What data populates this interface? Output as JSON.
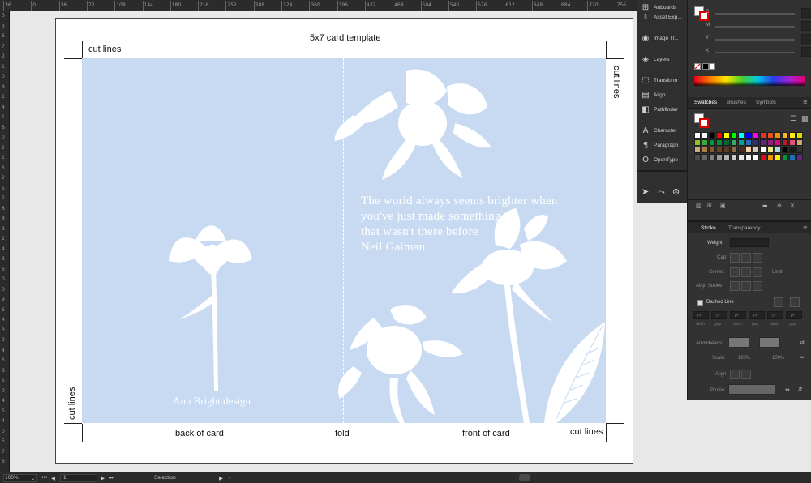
{
  "rulers": {
    "top_ticks": [
      "36",
      "0",
      "36",
      "72",
      "108",
      "144",
      "180",
      "216",
      "252",
      "288",
      "324",
      "360",
      "396",
      "432",
      "468",
      "504",
      "540",
      "576",
      "612",
      "648",
      "684",
      "720",
      "756"
    ],
    "left_ticks": [
      "0",
      "3",
      "6",
      "7",
      "2",
      "1",
      "0",
      "8",
      "1",
      "4",
      "1",
      "8",
      "0",
      "2",
      "1",
      "6",
      "2",
      "5",
      "2",
      "8",
      "8",
      "3",
      "2",
      "4",
      "3",
      "6",
      "0",
      "3",
      "9",
      "6",
      "4",
      "3",
      "2",
      "4",
      "6",
      "8",
      "5",
      "0",
      "4",
      "5",
      "4",
      "0",
      "5",
      "7",
      "6"
    ]
  },
  "document": {
    "title": "5x7 card template",
    "labels": {
      "cut_top_left": "cut lines",
      "cut_right": "cut lines",
      "cut_left": "cut lines",
      "cut_bottom_right": "cut lines",
      "back": "back of card",
      "fold": "fold",
      "front": "front of card"
    },
    "quote": {
      "line1": "The world always seems brighter when",
      "line2": "you've just made something",
      "line3": "that wasn't there before",
      "line4": "Neil Gaiman"
    },
    "signature": "Ann Bright design",
    "colors": {
      "card": "#c8daf2",
      "fold_line": "#ffffff"
    }
  },
  "panels": {
    "tool_items": [
      {
        "label": "Artboards",
        "icon": "artboards-icon",
        "glyph": "⊞"
      },
      {
        "label": "Asset Exp...",
        "icon": "asset-export-icon",
        "glyph": "⇧"
      },
      {
        "label": "Image Tr...",
        "icon": "image-trace-icon",
        "glyph": "◉"
      },
      {
        "label": "Layers",
        "icon": "layers-icon",
        "glyph": "◈"
      },
      {
        "label": "Transform",
        "icon": "transform-icon",
        "glyph": "⬚"
      },
      {
        "label": "Align",
        "icon": "align-icon",
        "glyph": "▤"
      },
      {
        "label": "Pathfinder",
        "icon": "pathfinder-icon",
        "glyph": "◧"
      },
      {
        "label": "Character",
        "icon": "character-icon",
        "glyph": "A"
      },
      {
        "label": "Paragraph",
        "icon": "paragraph-icon",
        "glyph": "¶"
      },
      {
        "label": "OpenType",
        "icon": "opentype-icon",
        "glyph": "O"
      }
    ],
    "color": {
      "channels": [
        "C",
        "M",
        "Y",
        "K"
      ],
      "percent": "%"
    },
    "swatch_tabs": {
      "swatches": "Swatches",
      "brushes": "Brushes",
      "symbols": "Symbols"
    },
    "swatches": {
      "colors": [
        "#ffffff",
        "#ffffff",
        "#000000",
        "#ff0000",
        "#ffff00",
        "#00ff00",
        "#00ffff",
        "#0000ff",
        "#ff00ff",
        "#e6332a",
        "#e94e1b",
        "#f39200",
        "#f9b233",
        "#fcea10",
        "#dedc00",
        "#95c11f",
        "#3aaa35",
        "#009640",
        "#008d36",
        "#006633",
        "#2fac66",
        "#00a19a",
        "#1d71b8",
        "#2d2e83",
        "#662483",
        "#951b81",
        "#e6007e",
        "#be1622",
        "#e94e77",
        "#d4a373",
        "#c8ad7f",
        "#b07d48",
        "#8a5a2b",
        "#6b4226",
        "#5c3a21",
        "#946b4a",
        "#4a2c17",
        "#f5d0a9",
        "#d9c7b8",
        "#ffffff",
        "#f0e68c",
        "#add8e6",
        "#000000",
        "#1a1a1a",
        "#333333",
        "#4d4d4d",
        "#666666",
        "#808080",
        "#999999",
        "#b3b3b3",
        "#cccccc",
        "#e6e6e6",
        "#f2f2f2",
        "#ffffff",
        "#e30613",
        "#f39200",
        "#ffed00",
        "#009640",
        "#1d71b8",
        "#662483"
      ]
    },
    "stroke": {
      "tab_stroke": "Stroke",
      "tab_transparency": "Transparency",
      "weight": "Weight:",
      "cap": "Cap:",
      "corner": "Corner:",
      "limit": "Limit:",
      "align_stroke": "Align Stroke:",
      "dashed_line": "Dashed Line",
      "dash_cells": [
        "dash",
        "gap",
        "dash",
        "gap",
        "dash",
        "gap"
      ],
      "dash_pt": "pt",
      "arrowheads": "Arrowheads:",
      "scale": "Scale:",
      "scale_value1": "100%",
      "scale_value2": "100%",
      "align": "Align:",
      "profile": "Profile:"
    }
  },
  "status_bar": {
    "zoom": "100%",
    "page": "1",
    "tool": "Selection"
  }
}
